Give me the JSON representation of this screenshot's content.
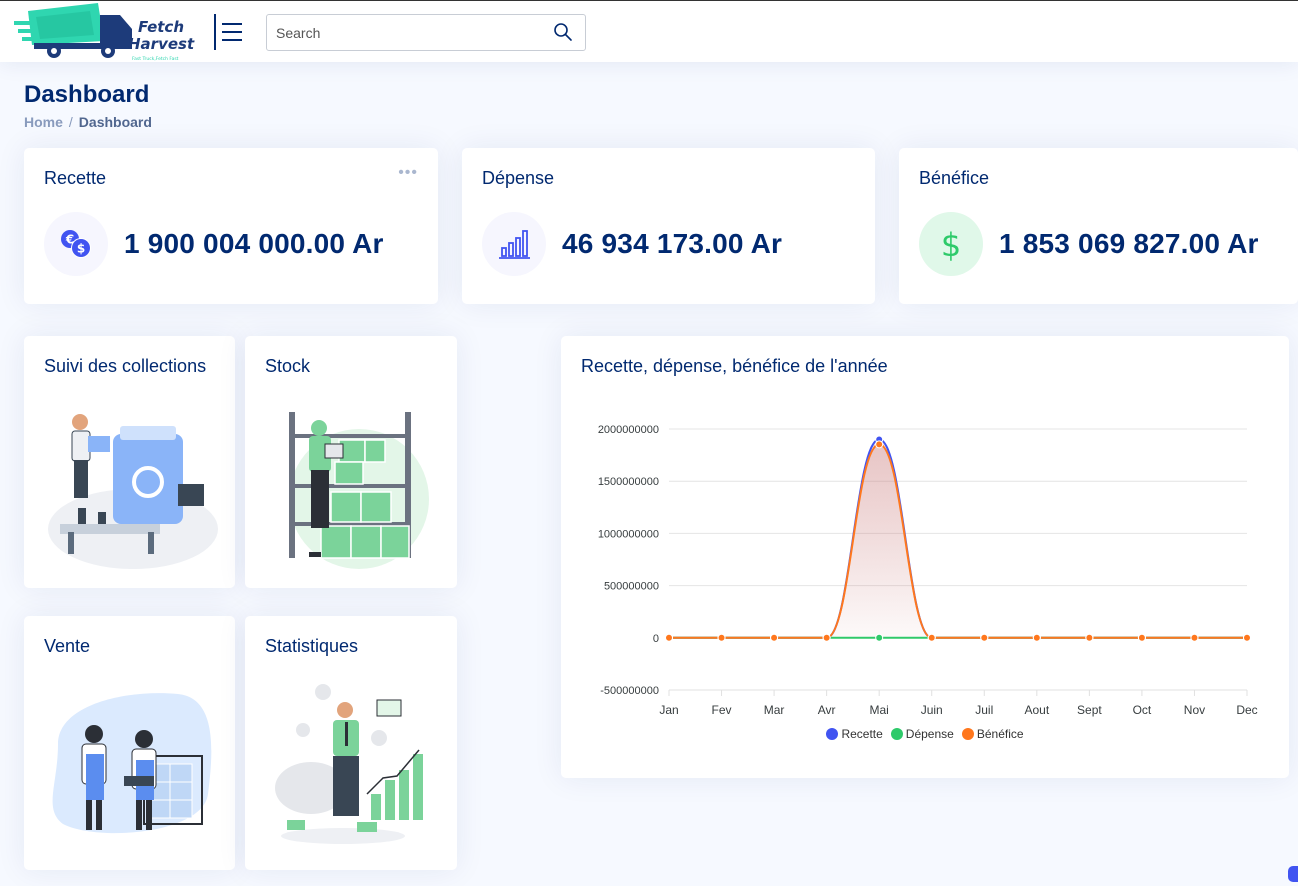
{
  "header": {
    "brand_line1": "Fetch",
    "brand_line2": "Harvest",
    "brand_tagline": "Fast Truck,Fetch Fast",
    "search_placeholder": "Search"
  },
  "page": {
    "title": "Dashboard",
    "breadcrumb": {
      "home": "Home",
      "separator": "/",
      "current": "Dashboard"
    }
  },
  "info_cards": [
    {
      "title": "Recette",
      "amount": "1 900 004 000.00 Ar",
      "icon": "euro-dollar-coins-icon",
      "menu": "•••"
    },
    {
      "title": "Dépense",
      "amount": "46 934 173.00 Ar",
      "icon": "bar-chart-icon"
    },
    {
      "title": "Bénéfice",
      "amount": "1 853 069 827.00 Ar",
      "icon": "dollar-icon",
      "symbol": "$"
    }
  ],
  "tiles": [
    {
      "title": "Suivi des collections",
      "icon": "recycling-worker-illustration"
    },
    {
      "title": "Stock",
      "icon": "warehouse-stock-illustration"
    },
    {
      "title": "Vente",
      "icon": "shop-sellers-illustration"
    },
    {
      "title": "Statistiques",
      "icon": "growth-statistics-illustration"
    }
  ],
  "colors": {
    "primary": "#012970",
    "recette": "#4154f1",
    "depense": "#2eca6a",
    "benefice": "#ff771d"
  },
  "chart_data": {
    "type": "area",
    "title": "Recette, dépense, bénéfice de l'année",
    "categories": [
      "Jan",
      "Fev",
      "Mar",
      "Avr",
      "Mai",
      "Juin",
      "Juil",
      "Aout",
      "Sept",
      "Oct",
      "Nov",
      "Dec"
    ],
    "series": [
      {
        "name": "Recette",
        "color": "#4154f1",
        "values": [
          0,
          0,
          0,
          0,
          1900004000,
          0,
          0,
          0,
          0,
          0,
          0,
          0
        ]
      },
      {
        "name": "Dépense",
        "color": "#2eca6a",
        "values": [
          0,
          0,
          0,
          0,
          0,
          0,
          0,
          0,
          0,
          0,
          0,
          0
        ]
      },
      {
        "name": "Bénéfice",
        "color": "#ff771d",
        "values": [
          0,
          0,
          0,
          0,
          1853069827,
          0,
          0,
          0,
          0,
          0,
          0,
          0
        ]
      }
    ],
    "yticks": [
      "2000000000",
      "1500000000",
      "1000000000",
      "500000000",
      "0",
      "-500000000"
    ],
    "ylim": [
      -500000000,
      2000000000
    ],
    "legend_position": "bottom",
    "grid": true
  }
}
